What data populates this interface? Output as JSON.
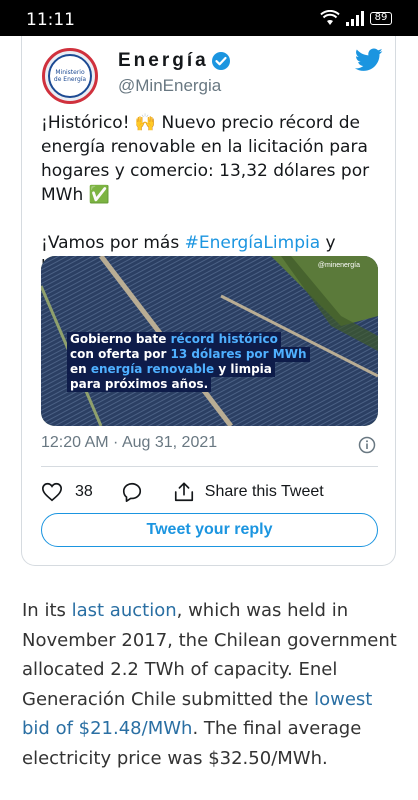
{
  "status_bar": {
    "time": "11:11",
    "battery": "89",
    "icons": [
      "wifi-icon",
      "signal-icon",
      "battery-icon"
    ]
  },
  "tweet": {
    "author_name": "Energía",
    "handle": "@MinEnergia",
    "avatar_text": "Ministerio de Energía",
    "paragraph1": "¡Histórico! 🙌 Nuevo precio récord de energía renovable en la licitación para hogares y comercio: 13,32 dólares por MWh ✅",
    "paragraph2_pre": "¡Vamos por más ",
    "hashtag": "#EnergíaLimpia",
    "paragraph2_post": " y barata para Chile! ⚡🇨🇱",
    "media": {
      "watermark": "@minenergía",
      "line1_pre": "Gobierno bate ",
      "line1_hl": "récord histórico",
      "line2_pre": "con oferta por ",
      "line2_hl": "13 dólares por MWh",
      "line3_pre": "en ",
      "line3_hl": "energía renovable",
      "line3_post": " y limpia",
      "line4": "para próximos años."
    },
    "timestamp": "12:20 AM · Aug 31, 2021",
    "like_count": "38",
    "share_label": "Share this Tweet",
    "reply_label": "Tweet your reply",
    "colors": {
      "accent": "#1b95e0",
      "text": "#14171a",
      "muted": "#697882"
    }
  },
  "article": {
    "t1": "In its ",
    "link1": "last auction",
    "t2": ", which was held in November 2017, the Chilean government allocated 2.2 TWh of capacity. Enel Generación Chile submitted the ",
    "link2": "lowest bid of $21.48/MWh",
    "t3": ". The final average electricity price was $32.50/MWh."
  }
}
